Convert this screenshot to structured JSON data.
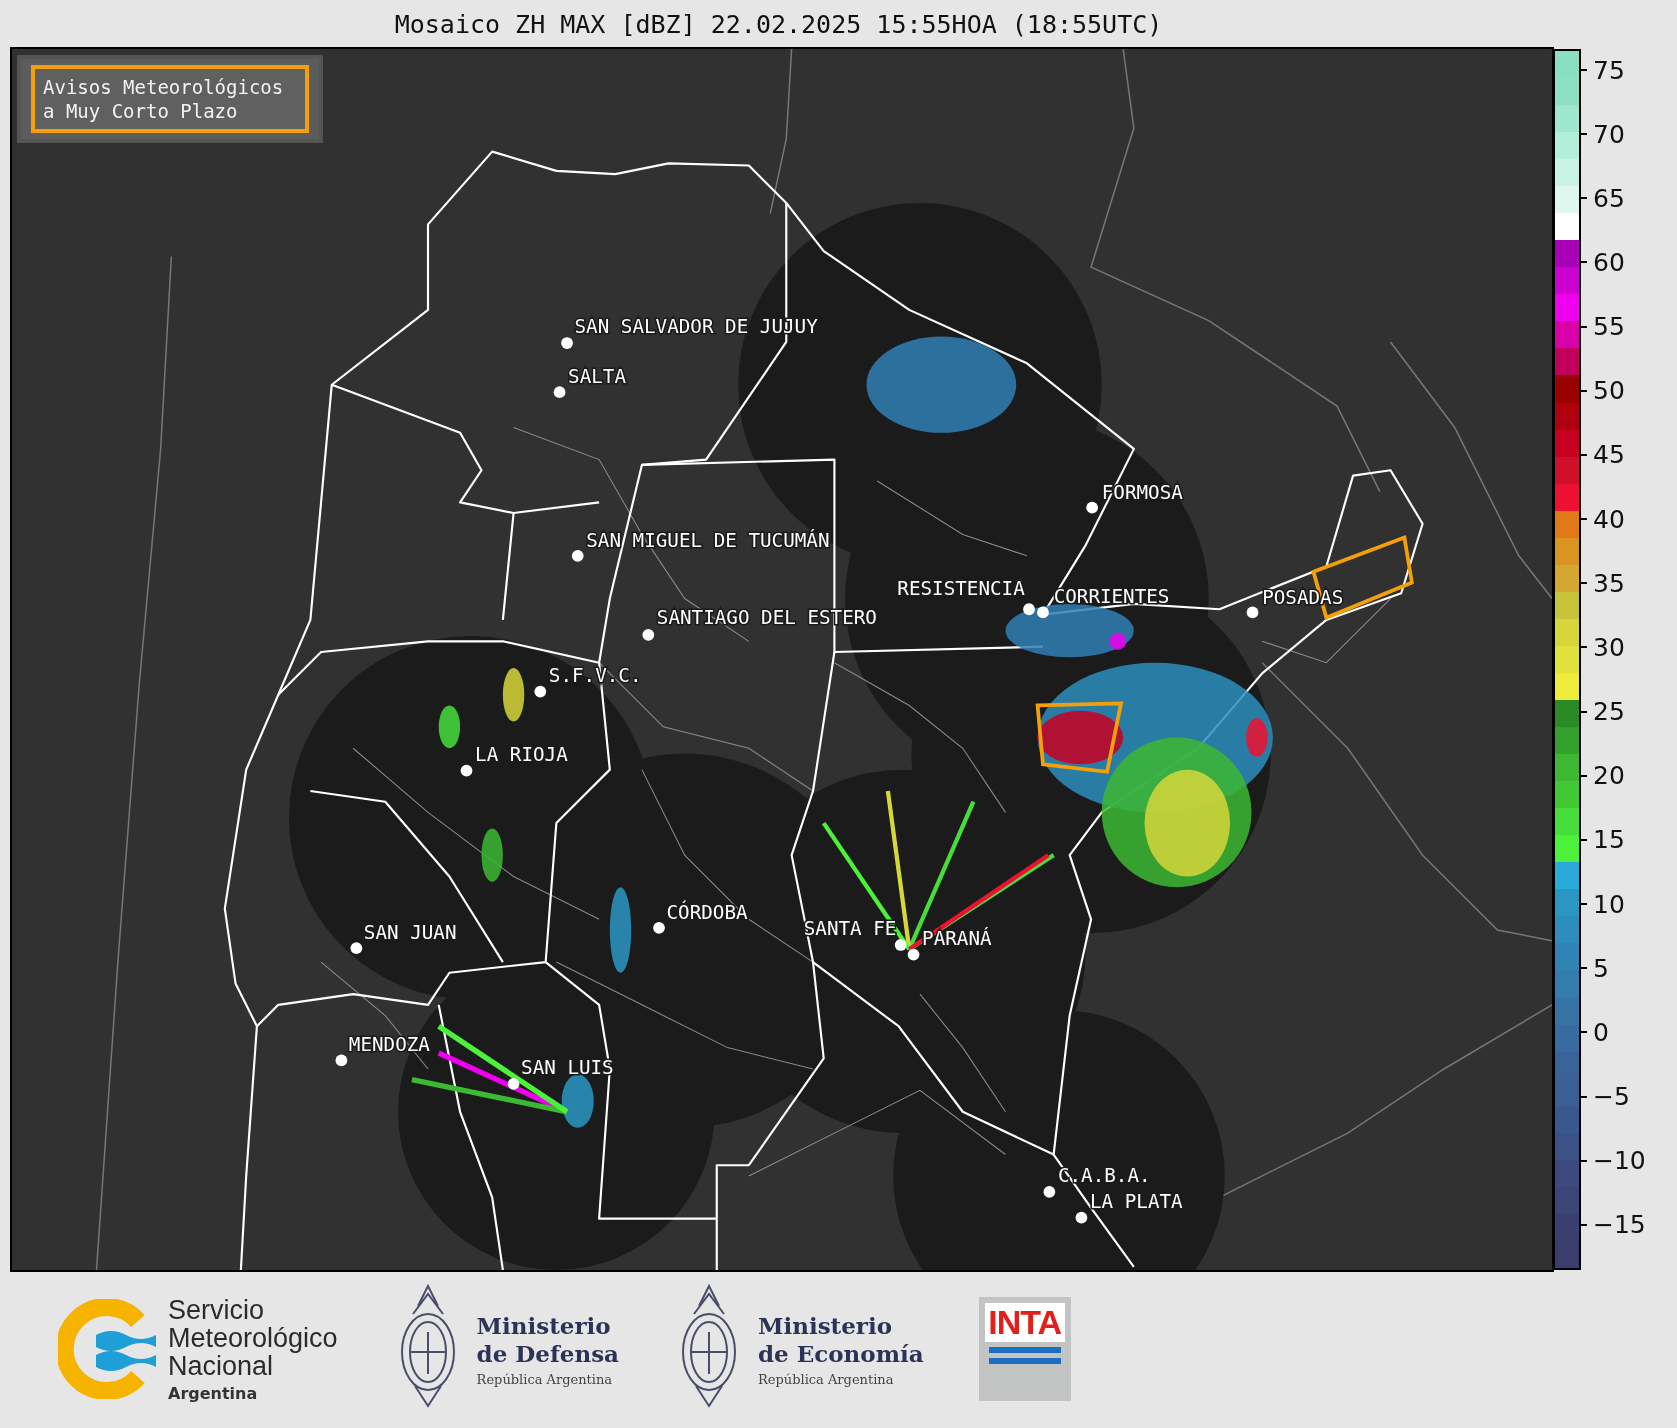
{
  "title": "Mosaico ZH MAX [dBZ] 22.02.2025 15:55HOA (18:55UTC)",
  "warning_legend": {
    "lines": [
      "Avisos Meteorológicos",
      "a Muy Corto Plazo"
    ]
  },
  "cities": [
    {
      "name": "SAN SALVADOR DE JUJUY"
    },
    {
      "name": "SALTA"
    },
    {
      "name": "SAN MIGUEL DE TUCUMÁN"
    },
    {
      "name": "SANTIAGO DEL ESTERO"
    },
    {
      "name": "FORMOSA"
    },
    {
      "name": "RESISTENCIA"
    },
    {
      "name": "CORRIENTES"
    },
    {
      "name": "POSADAS"
    },
    {
      "name": "S.F.V.C."
    },
    {
      "name": "LA RIOJA"
    },
    {
      "name": "CÓRDOBA"
    },
    {
      "name": "SAN JUAN"
    },
    {
      "name": "SANTA FE"
    },
    {
      "name": "PARANÁ"
    },
    {
      "name": "MENDOZA"
    },
    {
      "name": "SAN LUIS"
    },
    {
      "name": "C.A.B.A."
    },
    {
      "name": "LA PLATA"
    }
  ],
  "colorbar": {
    "segments": [
      {
        "color": "#3b3e6d"
      },
      {
        "color": "#3b3f6f"
      },
      {
        "color": "#3c4577"
      },
      {
        "color": "#3c4a7e"
      },
      {
        "color": "#3c5287"
      },
      {
        "color": "#3b588e"
      },
      {
        "color": "#3a5f95"
      },
      {
        "color": "#3a6498"
      },
      {
        "color": "#386c9f"
      },
      {
        "color": "#3674a6"
      },
      {
        "color": "#337dae"
      },
      {
        "color": "#3084b4"
      },
      {
        "color": "#2d8dbb"
      },
      {
        "color": "#2a97c3"
      },
      {
        "color": "#29aadb"
      },
      {
        "color": "#4cf23a"
      },
      {
        "color": "#45de3a"
      },
      {
        "color": "#40c935"
      },
      {
        "color": "#3cb833"
      },
      {
        "color": "#32a02b"
      },
      {
        "color": "#2a8a26"
      },
      {
        "color": "#eeec3a"
      },
      {
        "color": "#e2e03a"
      },
      {
        "color": "#d6d63a"
      },
      {
        "color": "#c8c43a"
      },
      {
        "color": "#d4a830"
      },
      {
        "color": "#da9422"
      },
      {
        "color": "#e07a18"
      },
      {
        "color": "#ee1030"
      },
      {
        "color": "#d0102a"
      },
      {
        "color": "#c80022"
      },
      {
        "color": "#b00010"
      },
      {
        "color": "#9a0000"
      },
      {
        "color": "#c0005a"
      },
      {
        "color": "#d800a8"
      },
      {
        "color": "#ee00ee"
      },
      {
        "color": "#cc00d0"
      },
      {
        "color": "#a800b4"
      },
      {
        "color": "#ffffff"
      },
      {
        "color": "#dff8ee"
      },
      {
        "color": "#c8f2e2"
      },
      {
        "color": "#b2eed8"
      },
      {
        "color": "#9ee6cc"
      },
      {
        "color": "#8ee0c2"
      },
      {
        "color": "#88e0c0"
      }
    ],
    "ticks": [
      "75",
      "70",
      "65",
      "60",
      "55",
      "50",
      "45",
      "40",
      "35",
      "30",
      "25",
      "20",
      "15",
      "10",
      "5",
      "0",
      "−5",
      "−10",
      "−15"
    ]
  },
  "logos": [
    {
      "kind": "smn",
      "lines": [
        "Servicio",
        "Meteorológico",
        "Nacional"
      ],
      "subline": "Argentina"
    },
    {
      "kind": "ministry",
      "lines": [
        "Ministerio",
        "de Defensa"
      ],
      "subline": "República Argentina"
    },
    {
      "kind": "ministry",
      "lines": [
        "Ministerio",
        "de Economía"
      ],
      "subline": "República Argentina"
    },
    {
      "kind": "inta",
      "lines": [
        "INTA"
      ]
    }
  ]
}
